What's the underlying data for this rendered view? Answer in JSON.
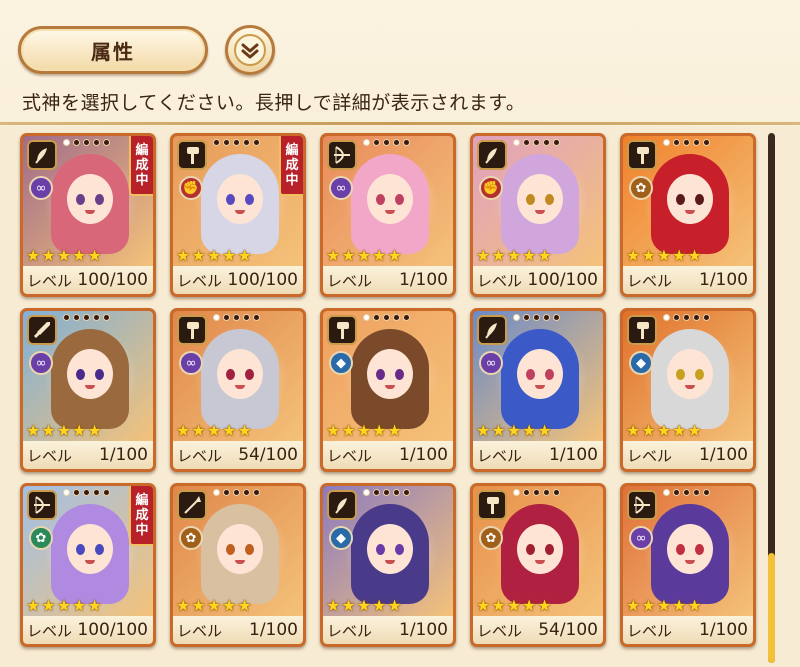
{
  "header": {
    "attribute_button_label": "属性",
    "instruction": "式神を選択してください。長押しで詳細が表示されます。"
  },
  "cards": [
    {
      "weapon": "scroll-icon",
      "element": "infinity",
      "element_color": "#6b3fa8",
      "stars": 5,
      "formation": true,
      "level": "100/100",
      "hair": "#d9677a",
      "bg": "#a06b8a",
      "eyes": "#6a3f8a",
      "dots": 1
    },
    {
      "weapon": "hammer-icon",
      "element": "fist",
      "element_color": "#b23030",
      "stars": 5,
      "formation": true,
      "level": "100/100",
      "hair": "#d6d6e6",
      "bg": "#e79a5a",
      "eyes": "#5a4ac0",
      "dots": 0
    },
    {
      "weapon": "bow-icon",
      "element": "infinity",
      "element_color": "#6b3fa8",
      "stars": 5,
      "formation": false,
      "level": "1/100",
      "hair": "#f2a6c8",
      "bg": "#e98a5c",
      "eyes": "#c04060",
      "dots": 1
    },
    {
      "weapon": "scroll-icon",
      "element": "fist",
      "element_color": "#b23030",
      "stars": 5,
      "formation": false,
      "level": "100/100",
      "hair": "#d0a6dc",
      "bg": "#e0a0c0",
      "eyes": "#c08a20",
      "dots": 1
    },
    {
      "weapon": "hammer-icon",
      "element": "lotus",
      "element_color": "#a0601a",
      "stars": 5,
      "formation": false,
      "level": "1/100",
      "hair": "#c8202a",
      "bg": "#f0802a",
      "eyes": "#5a1a1a",
      "dots": 1
    },
    {
      "weapon": "sword-icon",
      "element": "infinity",
      "element_color": "#6b3fa8",
      "stars": 5,
      "formation": false,
      "level": "1/100",
      "hair": "#9a6a3e",
      "bg": "#7fb0d8",
      "eyes": "#4a2a8a",
      "dots": 0
    },
    {
      "weapon": "hammer-icon",
      "element": "infinity",
      "element_color": "#6b3fa8",
      "stars": 5,
      "formation": false,
      "level": "54/100",
      "hair": "#c8c8d4",
      "bg": "#e0874a",
      "eyes": "#a02040",
      "dots": 1
    },
    {
      "weapon": "hammer-icon",
      "element": "diamond",
      "element_color": "#2a6aa8",
      "stars": 5,
      "formation": false,
      "level": "1/100",
      "hair": "#7a4a2a",
      "bg": "#efa060",
      "eyes": "#6a2a8a",
      "dots": 1
    },
    {
      "weapon": "scroll-icon",
      "element": "infinity",
      "element_color": "#6b3fa8",
      "stars": 5,
      "formation": false,
      "level": "1/100",
      "hair": "#3b5ac8",
      "bg": "#6a8ac8",
      "eyes": "#c04060",
      "dots": 1
    },
    {
      "weapon": "hammer-icon",
      "element": "diamond",
      "element_color": "#2a6aa8",
      "stars": 5,
      "formation": false,
      "level": "1/100",
      "hair": "#d8d8d8",
      "bg": "#e0702a",
      "eyes": "#c8a020",
      "dots": 1
    },
    {
      "weapon": "bow-icon",
      "element": "lotus",
      "element_color": "#2a8a5a",
      "stars": 5,
      "formation": true,
      "level": "100/100",
      "hair": "#b08ae0",
      "bg": "#a0c0e8",
      "eyes": "#4a4ac0",
      "dots": 1
    },
    {
      "weapon": "spear-icon",
      "element": "lotus",
      "element_color": "#a0601a",
      "stars": 5,
      "formation": false,
      "level": "1/100",
      "hair": "#d8c0a0",
      "bg": "#e0874a",
      "eyes": "#c06020",
      "dots": 1
    },
    {
      "weapon": "scroll-icon",
      "element": "diamond",
      "element_color": "#2a6aa8",
      "stars": 5,
      "formation": false,
      "level": "1/100",
      "hair": "#4a3a8a",
      "bg": "#8a7ac0",
      "eyes": "#6a3aa8",
      "dots": 1
    },
    {
      "weapon": "hammer-icon",
      "element": "lotus",
      "element_color": "#a0601a",
      "stars": 5,
      "formation": false,
      "level": "54/100",
      "hair": "#b02040",
      "bg": "#e8904a",
      "eyes": "#a02030",
      "dots": 1
    },
    {
      "weapon": "bow-icon",
      "element": "infinity",
      "element_color": "#6b3fa8",
      "stars": 5,
      "formation": false,
      "level": "1/100",
      "hair": "#5a3a9a",
      "bg": "#e0703a",
      "eyes": "#c03040",
      "dots": 1
    }
  ],
  "labels": {
    "level": "レベル",
    "formation": "編成中"
  },
  "scrollbar": {
    "thumb_color": "#f3c03a"
  }
}
